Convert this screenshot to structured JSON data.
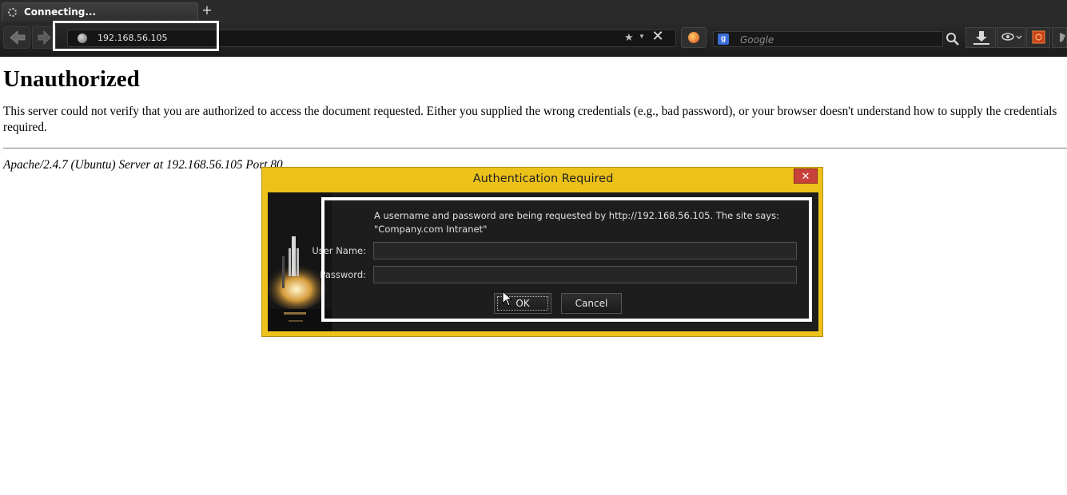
{
  "browser": {
    "tab": {
      "title": "Connecting..."
    },
    "new_tab_label": "+",
    "address_bar": {
      "url": "192.168.56.105"
    },
    "search": {
      "placeholder": "Google"
    }
  },
  "page": {
    "heading": "Unauthorized",
    "message": "This server could not verify that you are authorized to access the document requested. Either you supplied the wrong credentials (e.g., bad password), or your browser doesn't understand how to supply the credentials required.",
    "server_signature": "Apache/2.4.7 (Ubuntu) Server at 192.168.56.105 Port 80"
  },
  "dialog": {
    "title": "Authentication Required",
    "close_label": "✕",
    "message_line1": "A username and password are being requested by http://192.168.56.105. The site says:",
    "message_line2": "\"Company.com Intranet\"",
    "username_label": "User Name:",
    "password_label": "Password:",
    "username_value": "",
    "password_value": "",
    "ok_label": "OK",
    "cancel_label": "Cancel"
  },
  "colors": {
    "dialog_frame": "#ecc21a",
    "dialog_body": "#1d1d1d",
    "close_button": "#c8413a",
    "toolbar": "#1c1c1c"
  },
  "icons": [
    "loading-spinner-icon",
    "back-arrow-icon",
    "forward-arrow-icon",
    "globe-icon",
    "bookmark-star-icon",
    "stop-icon",
    "firefox-icon",
    "google-icon",
    "magnifier-icon",
    "download-icon",
    "eye-icon",
    "addon-icon"
  ]
}
